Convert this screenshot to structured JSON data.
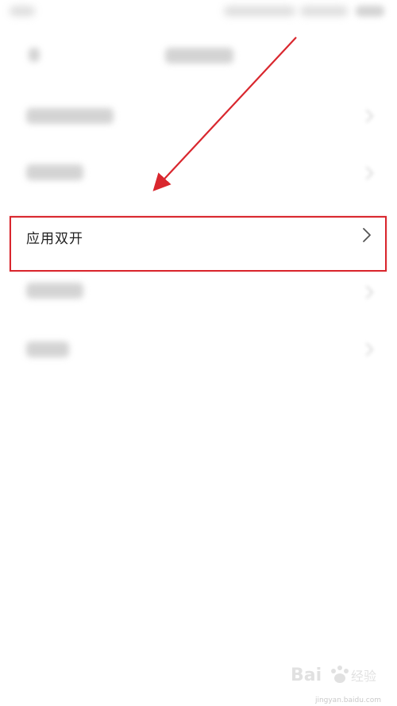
{
  "highlighted_item": {
    "label": "应用双开",
    "chevron_icon": "chevron-right-icon"
  },
  "annotation": {
    "color": "#d9272e"
  },
  "watermark": {
    "brand": "Bai",
    "brand_suffix": "经验",
    "site": "jingyan.baidu.com"
  }
}
